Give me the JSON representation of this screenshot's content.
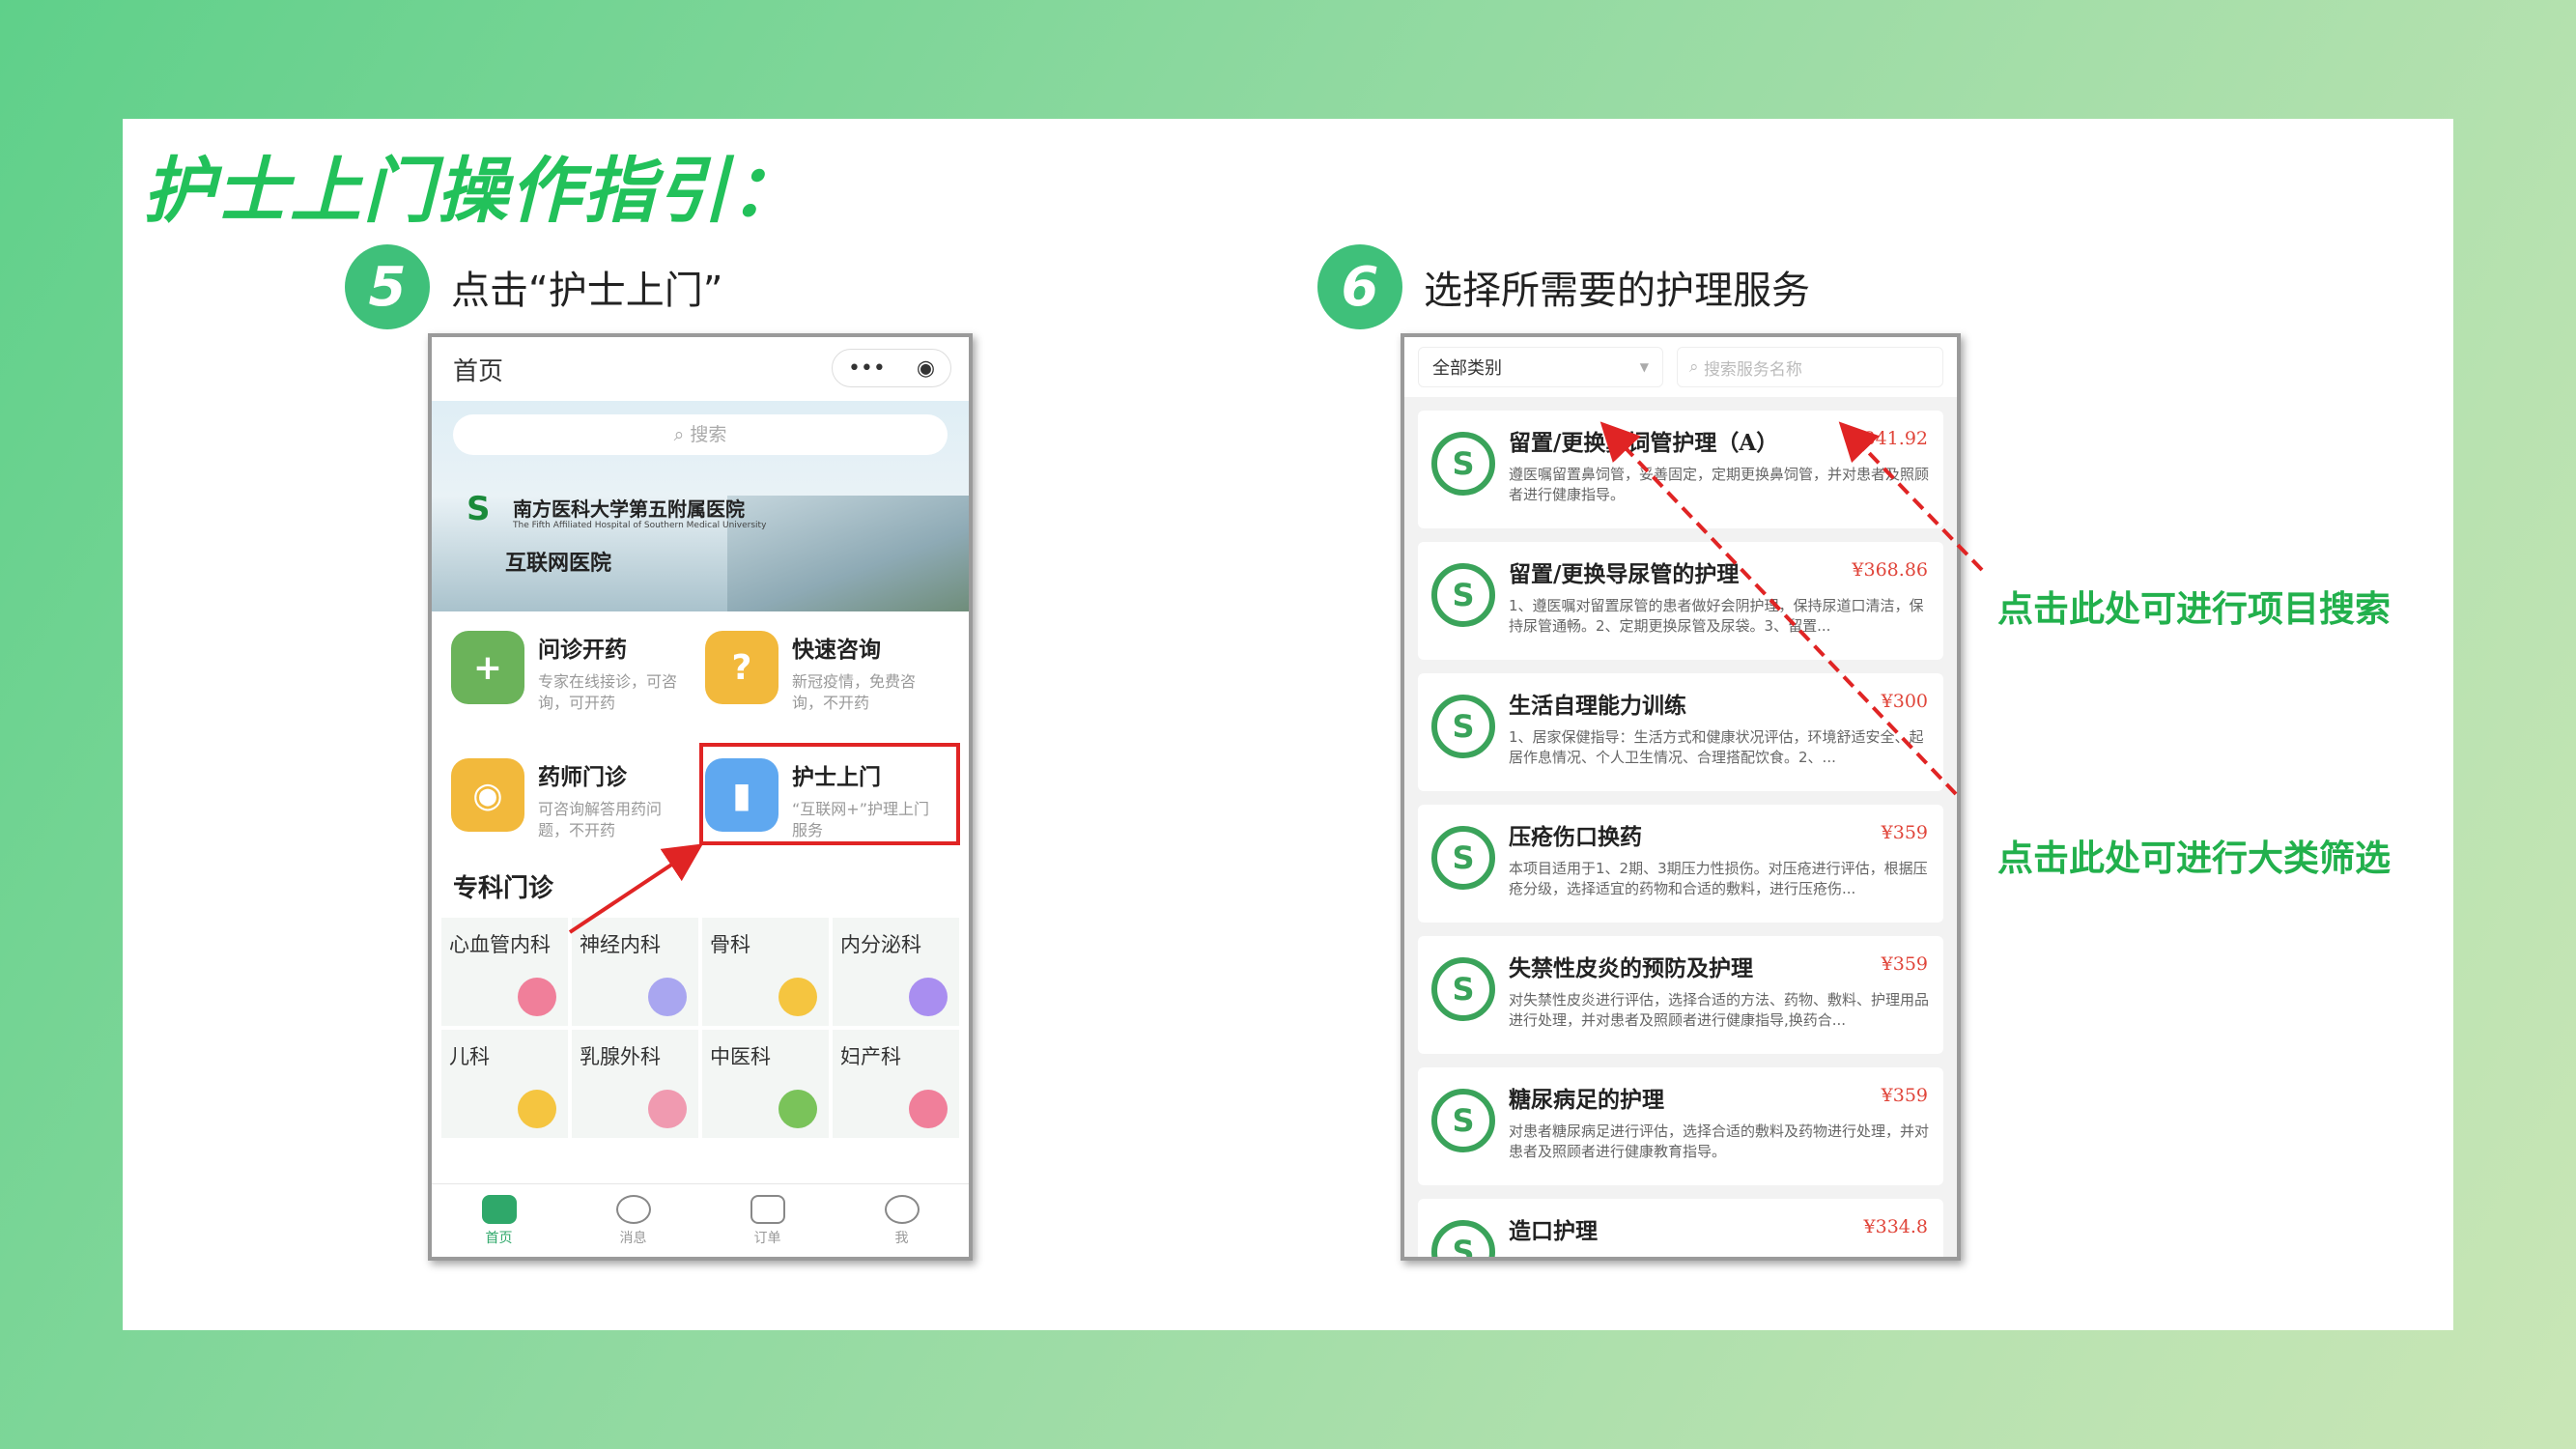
{
  "main_title": "护士上门操作指引：",
  "steps": [
    {
      "number": "5",
      "text": "点击“护士上门”"
    },
    {
      "number": "6",
      "text": "选择所需要的护理服务"
    }
  ],
  "phone1": {
    "title": "首页",
    "capsule_more": "•••",
    "capsule_close": "◉",
    "search_placeholder": "搜索",
    "hospital": {
      "logo_text": "S",
      "name": "南方医科大学第五附属医院",
      "subname": "The Fifth Affiliated Hospital of Southern Medical University",
      "net": "互联网医院"
    },
    "services": [
      {
        "title": "问诊开药",
        "desc": "专家在线接诊，可咨询，可开药",
        "icon": "+",
        "color": "#6bb35a"
      },
      {
        "title": "快速咨询",
        "desc": "新冠疫情，免费咨询，不开药",
        "icon": "?",
        "color": "#f2b93c"
      },
      {
        "title": "药师门诊",
        "desc": "可咨询解答用药问题，不开药",
        "icon": "◉",
        "color": "#f2b93c"
      },
      {
        "title": "护士上门",
        "desc": "“互联网+”护理上门服务",
        "icon": "▮",
        "color": "#5fa8f0"
      }
    ],
    "section_title": "专科门诊",
    "departments": [
      {
        "name": "心血管内科",
        "color": "#f07f9a"
      },
      {
        "name": "神经内科",
        "color": "#a9a6f0"
      },
      {
        "name": "骨科",
        "color": "#f5c540"
      },
      {
        "name": "内分泌科",
        "color": "#a98ef0"
      },
      {
        "name": "儿科",
        "color": "#f5c540"
      },
      {
        "name": "乳腺外科",
        "color": "#f09ab0"
      },
      {
        "name": "中医科",
        "color": "#7ac35a"
      },
      {
        "name": "妇产科",
        "color": "#f07f9a"
      }
    ],
    "tabs": [
      "首页",
      "消息",
      "订单",
      "我"
    ]
  },
  "phone2": {
    "category_select": "全部类别",
    "search_placeholder": "搜索服务名称",
    "items": [
      {
        "title": "留置/更换鼻饲管护理（A）",
        "price": "¥341.92",
        "desc": "遵医嘱留置鼻饲管，妥善固定，定期更换鼻饲管，并对患者及照顾者进行健康指导。"
      },
      {
        "title": "留置/更换导尿管的护理",
        "price": "¥368.86",
        "desc": "1、遵医嘱对留置尿管的患者做好会阴护理，保持尿道口清洁，保持尿管通畅。2、定期更换尿管及尿袋。3、留置..."
      },
      {
        "title": "生活自理能力训练",
        "price": "¥300",
        "desc": "1、居家保健指导：生活方式和健康状况评估，环境舒适安全、起居作息情况、个人卫生情况、合理搭配饮食。2、..."
      },
      {
        "title": "压疮伤口换药",
        "price": "¥359",
        "desc": "本项目适用于1、2期、3期压力性损伤。对压疮进行评估，根据压疮分级，选择适宜的药物和合适的敷料，进行压疮伤..."
      },
      {
        "title": "失禁性皮炎的预防及护理",
        "price": "¥359",
        "desc": "对失禁性皮炎进行评估，选择合适的方法、药物、敷料、护理用品进行处理，并对患者及照顾者进行健康指导,换药合..."
      },
      {
        "title": "糖尿病足的护理",
        "price": "¥359",
        "desc": "对患者糖尿病足进行评估，选择合适的敷料及药物进行处理，并对患者及照顾者进行健康教育指导。"
      },
      {
        "title": "造口护理",
        "price": "¥334.8",
        "desc": ""
      }
    ],
    "logo_text": "S"
  },
  "annotations": {
    "search_hint": "点击此处可进行项目搜索",
    "filter_hint": "点击此处可进行大类筛选"
  },
  "colors": {
    "accent": "#22c15a",
    "highlight": "#e02424",
    "price": "#e0453a"
  }
}
